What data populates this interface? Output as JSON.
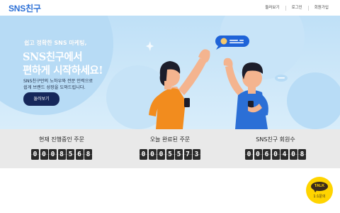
{
  "header": {
    "logo": "SNS친구",
    "nav": [
      "둘러보기",
      "로그인",
      "회원가입"
    ]
  },
  "hero": {
    "subtitle": "쉽고 정확한 SNS 마케팅,",
    "title_line1": "SNS친구에서",
    "title_line2": "편하게 시작하세요!",
    "desc_line1": "SNS친구만의 노하우와 전문 인력으로",
    "desc_line2": "쉽게 브랜드 성장을 도와드립니다.",
    "button": "둘러보기"
  },
  "stats": [
    {
      "label": "현재 진행중인 주문",
      "digits": [
        "0",
        "0",
        "0",
        "8",
        "5",
        "6",
        "8"
      ]
    },
    {
      "label": "오늘 완료된 주문",
      "digits": [
        "0",
        "0",
        "0",
        "5",
        "5",
        "7",
        "3"
      ]
    },
    {
      "label": "SNS친구 회원수",
      "digits": [
        "0",
        "0",
        "6",
        "0",
        "4",
        "0",
        "8"
      ]
    }
  ],
  "talk": {
    "label": "TALK",
    "sub": "1:1문의"
  },
  "colors": {
    "brand": "#2b6fd6",
    "hero_bg": "#cfe8f9",
    "button": "#16275a",
    "stats_bg": "#e9e9e9",
    "talk": "#ffd400"
  },
  "icons": [
    "thumbs-up-icon",
    "chat-bubble-icon",
    "smartphone-icon",
    "kakao-talk-icon"
  ]
}
